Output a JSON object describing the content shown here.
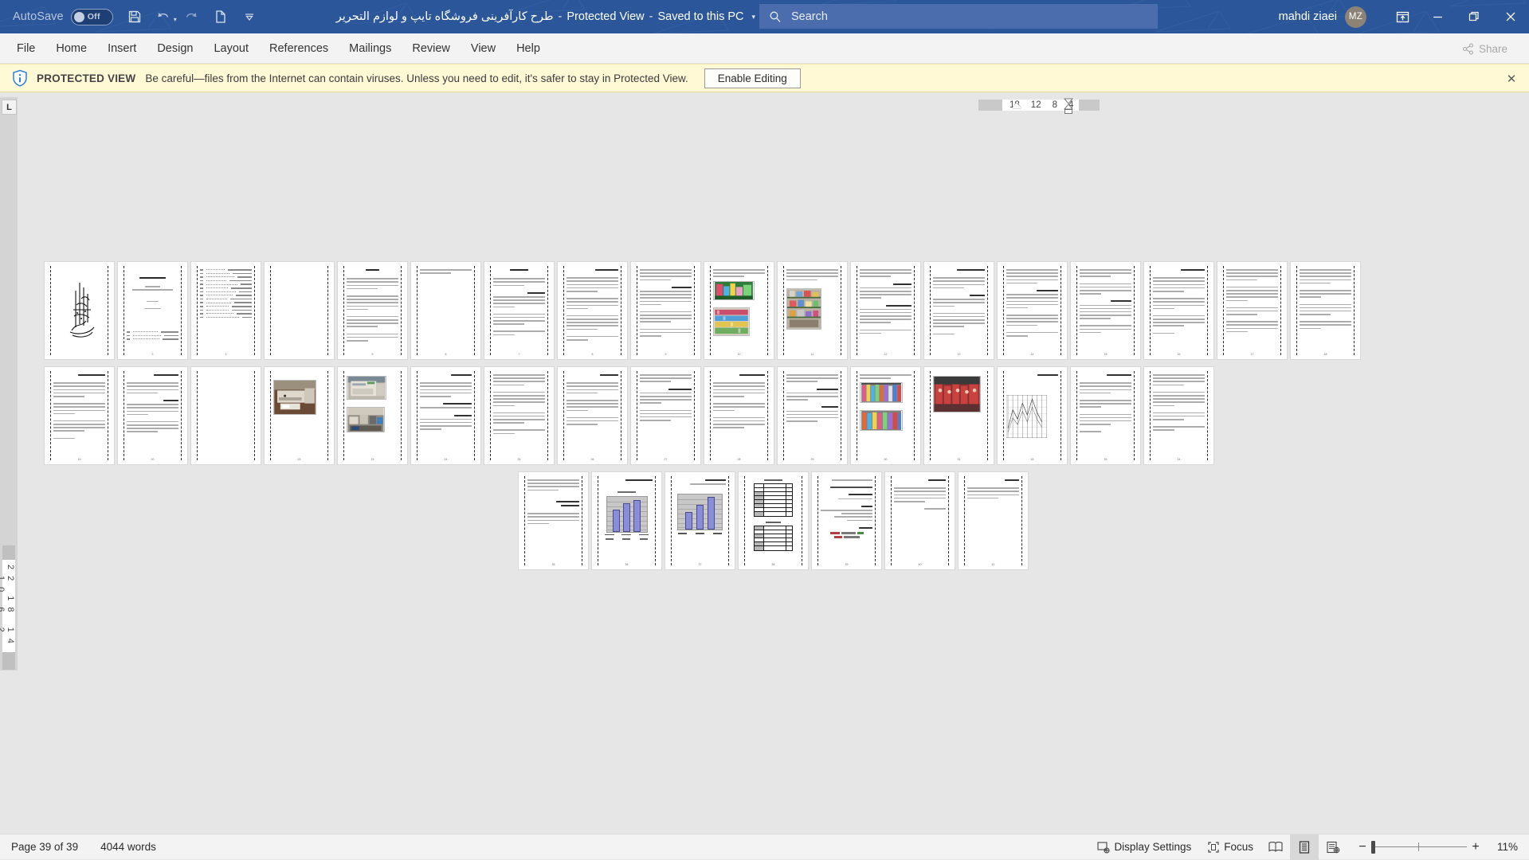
{
  "titlebar": {
    "autosave_label": "AutoSave",
    "autosave_state": "Off",
    "doc_title": "طرح کارآفرینی  فروشگاه تایپ و لوازم التحریر",
    "protected_label": "Protected View",
    "saved_label": "Saved to this PC",
    "separator": "-",
    "user_name": "mahdi ziaei",
    "user_initials": "MZ",
    "qat": [
      {
        "name": "save-icon",
        "label": "Save"
      },
      {
        "name": "undo-icon",
        "label": "Undo"
      },
      {
        "name": "redo-icon",
        "label": "Redo"
      },
      {
        "name": "new-doc-icon",
        "label": "New"
      },
      {
        "name": "customize-qat-icon",
        "label": "Customize Quick Access Toolbar"
      }
    ],
    "window_buttons": [
      {
        "name": "minimize-button",
        "glyph": "—"
      },
      {
        "name": "restore-button",
        "glyph": "❐"
      },
      {
        "name": "close-button",
        "glyph": "✕"
      }
    ],
    "accent_color": "#2b579a"
  },
  "search": {
    "placeholder": "Search",
    "icon": "search-icon"
  },
  "ribbon": {
    "tabs": [
      {
        "label": "File"
      },
      {
        "label": "Home"
      },
      {
        "label": "Insert"
      },
      {
        "label": "Design"
      },
      {
        "label": "Layout"
      },
      {
        "label": "References"
      },
      {
        "label": "Mailings"
      },
      {
        "label": "Review"
      },
      {
        "label": "View"
      },
      {
        "label": "Help"
      }
    ],
    "share_label": "Share"
  },
  "protected_view": {
    "icon": "shield-info-icon",
    "title": "PROTECTED VIEW",
    "message": "Be careful—files from the Internet can contain viruses. Unless you need to edit, it's safer to stay in Protected View.",
    "enable_label": "Enable Editing",
    "close_glyph": "✕",
    "bg_color": "#fff9d6"
  },
  "ruler": {
    "horizontal_numbers": [
      "18",
      "12",
      "8",
      "4"
    ],
    "vertical_numbers": "22 18 14 10 6 2",
    "vertical_top_number": "2",
    "tab_stop_glyph": "L"
  },
  "statusbar": {
    "page_indicator": "Page 39 of 39",
    "word_count": "4044 words",
    "display_settings_label": "Display Settings",
    "focus_label": "Focus",
    "view_buttons": [
      {
        "name": "read-mode-button",
        "label": "Read Mode"
      },
      {
        "name": "print-layout-button",
        "label": "Print Layout",
        "active": true
      },
      {
        "name": "web-layout-button",
        "label": "Web Layout"
      }
    ],
    "zoom_minus": "−",
    "zoom_plus": "+",
    "zoom_value": "11%"
  },
  "document": {
    "total_pages": 39,
    "rows": [
      {
        "count": 16,
        "centered": false
      },
      {
        "count": 16,
        "centered": false
      },
      {
        "count": 7,
        "centered": true
      }
    ],
    "pages": [
      {
        "n": 1,
        "kind": "cover-calligraphy"
      },
      {
        "n": 2,
        "kind": "title-page"
      },
      {
        "n": 3,
        "kind": "toc"
      },
      {
        "n": 4,
        "kind": "blank"
      },
      {
        "n": 5,
        "kind": "text-heading"
      },
      {
        "n": 6,
        "kind": "text-sparse"
      },
      {
        "n": 7,
        "kind": "text-heading"
      },
      {
        "n": 8,
        "kind": "text-full"
      },
      {
        "n": 9,
        "kind": "text-full"
      },
      {
        "n": 10,
        "kind": "photo-two"
      },
      {
        "n": 11,
        "kind": "photo-one"
      },
      {
        "n": 12,
        "kind": "text-full"
      },
      {
        "n": 13,
        "kind": "text-heading"
      },
      {
        "n": 14,
        "kind": "text-full"
      },
      {
        "n": 15,
        "kind": "text-full"
      },
      {
        "n": 16,
        "kind": "text-full"
      },
      {
        "n": 17,
        "kind": "text-full"
      },
      {
        "n": 18,
        "kind": "text-full"
      },
      {
        "n": 19,
        "kind": "blank"
      },
      {
        "n": 20,
        "kind": "photo-machine"
      },
      {
        "n": 21,
        "kind": "photo-two-machine"
      },
      {
        "n": 22,
        "kind": "text-heading"
      },
      {
        "n": 23,
        "kind": "text-full"
      },
      {
        "n": 24,
        "kind": "text-heading"
      },
      {
        "n": 25,
        "kind": "text-full"
      },
      {
        "n": 26,
        "kind": "text-heading"
      },
      {
        "n": 27,
        "kind": "text-heading"
      },
      {
        "n": 28,
        "kind": "photo-clothes"
      },
      {
        "n": 29,
        "kind": "photo-market"
      },
      {
        "n": 30,
        "kind": "line-chart"
      },
      {
        "n": 31,
        "kind": "text-full"
      },
      {
        "n": 32,
        "kind": "text-full"
      },
      {
        "n": 33,
        "kind": "text-heading"
      },
      {
        "n": 34,
        "kind": "bar-chart"
      },
      {
        "n": 35,
        "kind": "bar-chart-2"
      },
      {
        "n": 36,
        "kind": "tables"
      },
      {
        "n": 37,
        "kind": "text-heading"
      },
      {
        "n": 38,
        "kind": "text-sparse"
      },
      {
        "n": 39,
        "kind": "text-sparse"
      }
    ]
  },
  "chart_data": [
    {
      "type": "bar",
      "page": 34,
      "title": "نمودار فروش سالانه",
      "categories": [
        "سال اول",
        "سال دوم",
        "سال سوم"
      ],
      "values": [
        300,
        400,
        450
      ],
      "xlabel": "",
      "ylabel": "",
      "ylim": [
        0,
        500
      ],
      "grid": true,
      "legend": "bottom",
      "series_color": "#8a8ed8"
    },
    {
      "type": "bar",
      "page": 35,
      "title": "نمودار سود سالانه",
      "categories": [
        "سال اول",
        "سال دوم",
        "سال سوم"
      ],
      "values": [
        200,
        280,
        380
      ],
      "xlabel": "",
      "ylabel": "",
      "ylim": [
        0,
        450
      ],
      "grid": true,
      "legend": "none",
      "series_color": "#8a8ed8"
    },
    {
      "type": "line",
      "page": 30,
      "title": "نمودار تحلیلی",
      "x": [
        1,
        2,
        3,
        4,
        5,
        6,
        7,
        8
      ],
      "values": [
        20,
        45,
        30,
        60,
        40,
        75,
        50,
        35
      ],
      "xlabel": "",
      "ylabel": "",
      "grid": true,
      "legend": "none",
      "series_color": "#4a4a4a"
    }
  ]
}
